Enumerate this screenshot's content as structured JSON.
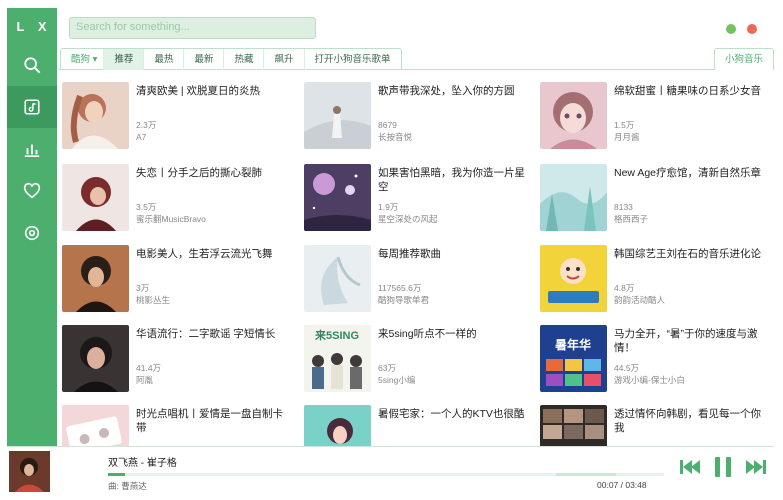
{
  "app": {
    "logo": "L X"
  },
  "search": {
    "placeholder": "Search for something..."
  },
  "tabs": {
    "source": "酷狗 ▾",
    "items": [
      "推荐",
      "最热",
      "最新",
      "热藏",
      "飙升",
      "打开小狗音乐歌单"
    ],
    "right": "小狗音乐"
  },
  "playlists": [
    {
      "title": "清爽欧美 | 欢脱夏日的炎热",
      "count": "2.3万",
      "author": "A7"
    },
    {
      "title": "歌声带我深处，坠入你的方圆",
      "count": "8679",
      "author": "长按音悦"
    },
    {
      "title": "绵软甜蜜丨糖果味の日系少女音",
      "count": "1.5万",
      "author": "月月酱"
    },
    {
      "title": "失恋丨分手之后的撕心裂肺",
      "count": "3.5万",
      "author": "蜜乐翻MusicBravo"
    },
    {
      "title": "如果害怕黑暗，我为你造一片星空",
      "count": "1.9万",
      "author": "星空深处の风起"
    },
    {
      "title": "New Age疗愈馆，清新自然乐章",
      "count": "8133",
      "author": "格西西子"
    },
    {
      "title": "电影美人，生若浮云流光飞舞",
      "count": "3万",
      "author": "桃影丛生"
    },
    {
      "title": "每周推荐歌曲",
      "count": "117565.6万",
      "author": "酷狗导歌单君"
    },
    {
      "title": "韩国综艺王刘在石的音乐进化论",
      "count": "4.8万",
      "author": "韵韵活动酷人"
    },
    {
      "title": "华语流行：二字歌谣 字短情长",
      "count": "41.4万",
      "author": "阿胤"
    },
    {
      "title": "来5sing听点不一样的",
      "count": "63万",
      "author": "5sing小编"
    },
    {
      "title": "马力全开，“暑”于你的速度与激情！",
      "count": "44.5万",
      "author": "游戏小编-保士小白"
    },
    {
      "title": "时光点唱机丨爱情是一盘自制卡带",
      "count": "",
      "author": ""
    },
    {
      "title": "暑假宅家：一个人的KTV也很酷",
      "count": "",
      "author": ""
    },
    {
      "title": "透过情怀向韩剧，看见每一个你我",
      "count": "",
      "author": ""
    }
  ],
  "cover_text": {
    "c11": "来5SING",
    "c12": "暑年华"
  },
  "player": {
    "title": "双飞燕 - 崔子格",
    "artist": "曲: 曹燕达",
    "time": "00:07 / 03:48",
    "progress": 0.03
  },
  "colors": {
    "accent": "#4caf6e",
    "close": "#ec6a55",
    "minimize": "#76c160"
  }
}
